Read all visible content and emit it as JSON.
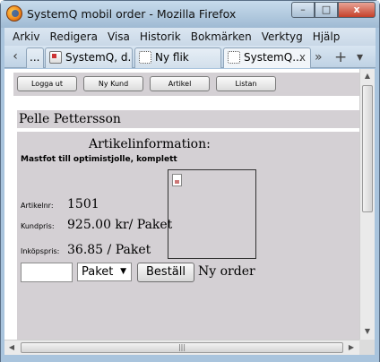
{
  "window": {
    "title": "SystemQ mobil order - Mozilla Firefox",
    "controls": {
      "minimize": "–",
      "maximize": "□",
      "close": "x"
    }
  },
  "menubar": {
    "items": [
      "Arkiv",
      "Redigera",
      "Visa",
      "Historik",
      "Bokmärken",
      "Verktyg",
      "Hjälp"
    ]
  },
  "tabs": {
    "back_arrow": "‹",
    "overflow_left": "...",
    "items": [
      {
        "label": "SystemQ, d...",
        "icon": "page-icon"
      },
      {
        "label": "Ny flik",
        "icon": "blank-page-icon"
      },
      {
        "label": "SystemQ...",
        "icon": "blank-page-icon",
        "close": "x"
      }
    ],
    "forward_arrow": "»",
    "new_tab": "+",
    "list_tabs": "▾"
  },
  "nav": {
    "logout_label": "Logga ut",
    "new_customer_label": "Ny Kund",
    "article_label": "Artikel",
    "list_label": "Listan"
  },
  "customer": {
    "name": "Pelle Pettersson"
  },
  "article": {
    "section_title": "Artikelinformation:",
    "name": "Mastfot till optimistjolle, komplett",
    "fields": [
      {
        "label": "Artikelnr:",
        "value": "1501"
      },
      {
        "label": "Kundpris:",
        "value": "925.00 kr/ Paket"
      },
      {
        "label": "Inköpspris:",
        "value": "36.85 / Paket"
      }
    ]
  },
  "order": {
    "quantity_value": "",
    "unit_selected": "Paket",
    "order_button_label": "Beställ",
    "new_order_label": "Ny order"
  },
  "scrollbars": {
    "grip": "|||",
    "up": "▲",
    "down": "▼",
    "left": "◀",
    "right": "▶"
  },
  "colors": {
    "panel": "#d4d0d4",
    "window_frame": "#a9c4dd"
  }
}
